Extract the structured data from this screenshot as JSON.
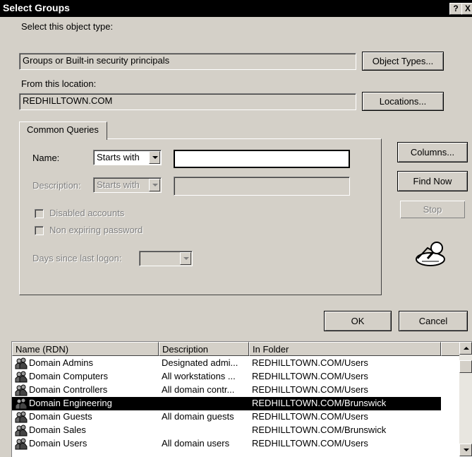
{
  "window": {
    "title": "Select Groups",
    "help_label": "?",
    "close_label": "X"
  },
  "object_type": {
    "label": "Select this object type:",
    "value": "Groups or Built-in security principals",
    "button": "Object Types..."
  },
  "location": {
    "label": "From this location:",
    "value": "REDHILLTOWN.COM",
    "button": "Locations..."
  },
  "queries": {
    "tab_label": "Common Queries",
    "name_label": "Name:",
    "name_mode": "Starts with",
    "name_value": "",
    "description_label": "Description:",
    "description_mode": "Starts with",
    "description_value": "",
    "disabled_accounts_label": "Disabled accounts",
    "non_expiring_label": "Non expiring password",
    "days_label": "Days since last logon:",
    "days_value": ""
  },
  "side_buttons": {
    "columns": "Columns...",
    "find_now": "Find Now",
    "stop": "Stop"
  },
  "dialog_buttons": {
    "ok": "OK",
    "cancel": "Cancel"
  },
  "results": {
    "columns": [
      "Name (RDN)",
      "Description",
      "In Folder"
    ],
    "rows": [
      {
        "name": "Domain Admins",
        "description": "Designated admi...",
        "folder": "REDHILLTOWN.COM/Users",
        "selected": false
      },
      {
        "name": "Domain Computers",
        "description": "All workstations ...",
        "folder": "REDHILLTOWN.COM/Users",
        "selected": false
      },
      {
        "name": "Domain Controllers",
        "description": "All domain contr...",
        "folder": "REDHILLTOWN.COM/Users",
        "selected": false
      },
      {
        "name": "Domain Engineering",
        "description": "",
        "folder": "REDHILLTOWN.COM/Brunswick",
        "selected": true
      },
      {
        "name": "Domain Guests",
        "description": "All domain guests",
        "folder": "REDHILLTOWN.COM/Users",
        "selected": false
      },
      {
        "name": "Domain Sales",
        "description": "",
        "folder": "REDHILLTOWN.COM/Brunswick",
        "selected": false
      },
      {
        "name": "Domain Users",
        "description": "All domain users",
        "folder": "REDHILLTOWN.COM/Users",
        "selected": false
      }
    ]
  },
  "icons": {
    "group": "group-icon",
    "search": "search-magnifier-icon"
  }
}
